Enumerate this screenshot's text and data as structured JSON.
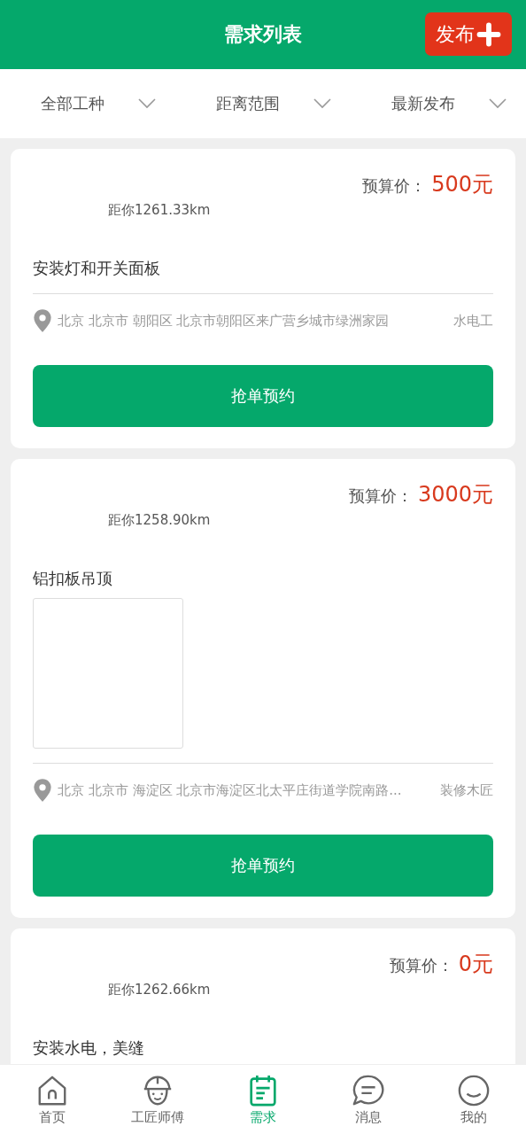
{
  "header": {
    "title": "需求列表",
    "publish_button": "发布"
  },
  "filters": [
    {
      "label": "全部工种"
    },
    {
      "label": "距离范围"
    },
    {
      "label": "最新发布"
    }
  ],
  "requests": [
    {
      "price_label": "预算价：",
      "price": "500元",
      "distance": "距你1261.33km",
      "title": "安装灯和开关面板",
      "address": "北京 北京市 朝阳区 北京市朝阳区来广营乡城市绿洲家园",
      "trade": "水电工",
      "action": "抢单预约"
    },
    {
      "price_label": "预算价：",
      "price": "3000元",
      "distance": "距你1258.90km",
      "title": "铝扣板吊顶",
      "photos": [
        {
          "kind": "empty"
        }
      ],
      "address": "北京 北京市 海淀区 北京市海淀区北太平庄街道学院南路...",
      "trade": "装修木匠",
      "action": "抢单预约"
    },
    {
      "price_label": "预算价：",
      "price": "0元",
      "distance": "距你1262.66km",
      "title": "安装水电，美缝"
    }
  ],
  "tabbar": [
    {
      "label": "首页",
      "kind": "home",
      "selected": false
    },
    {
      "label": "工匠师傅",
      "kind": "workers",
      "selected": false
    },
    {
      "label": "需求",
      "kind": "requests",
      "selected": true
    },
    {
      "label": "消息",
      "kind": "messages",
      "selected": false
    },
    {
      "label": "我的",
      "kind": "profile",
      "selected": false
    }
  ]
}
